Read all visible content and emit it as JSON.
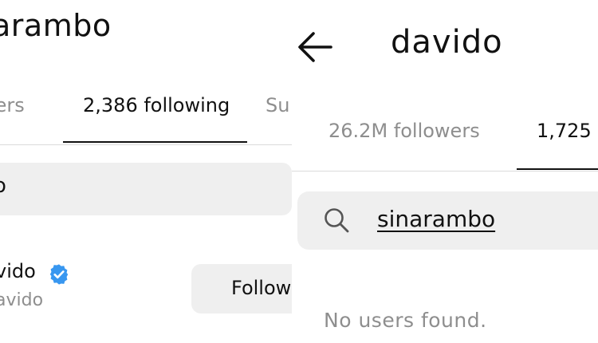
{
  "left_screen": {
    "header": {
      "title": "arambo"
    },
    "tabs": [
      {
        "label": "wers",
        "active": false
      },
      {
        "label": "2,386 following",
        "active": true
      },
      {
        "label": "Su",
        "active": false
      }
    ],
    "search": {
      "value": "o"
    },
    "user_row": {
      "username": "vido",
      "display_name": "avido",
      "verified": true,
      "follow_label": "Follow"
    }
  },
  "right_screen": {
    "header": {
      "title": "davido",
      "back_icon": "arrow-left-icon"
    },
    "tabs": [
      {
        "label": "26.2M followers",
        "active": false
      },
      {
        "label": "1,725",
        "active": true
      }
    ],
    "search": {
      "value": "sinarambo",
      "icon": "search-icon"
    },
    "empty_state": "No users found."
  },
  "colors": {
    "text_primary": "#111111",
    "text_secondary": "#8e8e8e",
    "field_background": "#efefef",
    "divider": "#dbdbdb",
    "verified_badge": "#3897f0"
  }
}
